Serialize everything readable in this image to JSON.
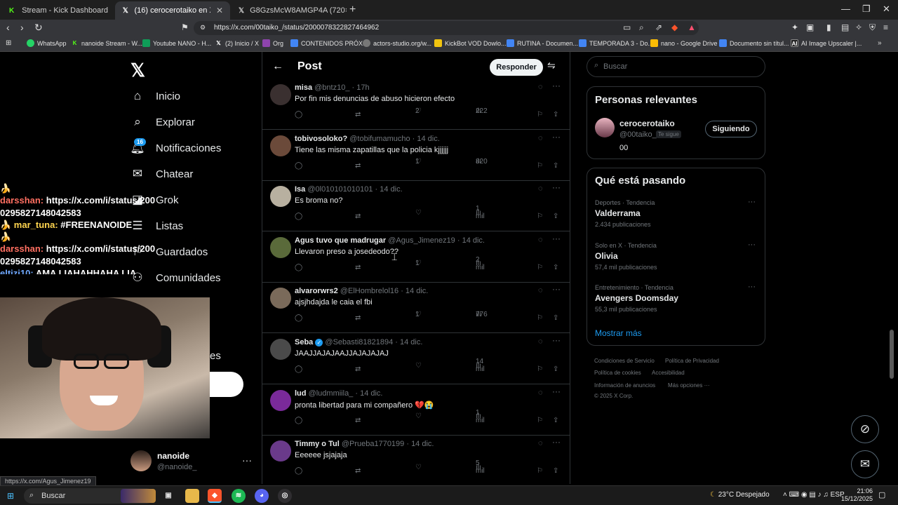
{
  "browser": {
    "tabs": [
      {
        "label": "Stream - Kick Dashboard",
        "icon": "kick-icon"
      },
      {
        "label": "(16) cerocerotaiko en X: \"cayo pr",
        "icon": "x-icon"
      },
      {
        "label": "G8GzsMcW8AMGP4A (720×1280)",
        "icon": "x-icon"
      }
    ],
    "url": "https://x.com/00taiko_/status/2000078322827464962",
    "bookmarks": [
      {
        "label": "WhatsApp",
        "color": "#25d366"
      },
      {
        "label": "nanoide Stream - W...",
        "color": "#53fc18"
      },
      {
        "label": "Youtube NANO - H...",
        "color": "#0f9d58"
      },
      {
        "label": "(2) Inicio / X",
        "color": "#333333"
      },
      {
        "label": "Org",
        "color": "#8e44ad"
      },
      {
        "label": "CONTENIDOS PRÓX...",
        "color": "#4285f4"
      },
      {
        "label": "actors-studio.org/w...",
        "color": "#777777"
      },
      {
        "label": "KickBot VOD Dowlo...",
        "color": "#f1c40f"
      },
      {
        "label": "RUTINA - Documen...",
        "color": "#4285f4"
      },
      {
        "label": "TEMPORADA 3 - Do...",
        "color": "#4285f4"
      },
      {
        "label": "nano - Google Drive",
        "color": "#fbbc04"
      },
      {
        "label": "Documento sin títul...",
        "color": "#4285f4"
      },
      {
        "label": "AI Image Upscaler |...",
        "color": "#222222"
      }
    ]
  },
  "chat": {
    "lines": [
      {
        "user": "",
        "text": "🍌"
      },
      {
        "user": "darsshan:",
        "text": "https://x.com/i/status/200"
      },
      {
        "user": "",
        "text": "0295827148042583"
      },
      {
        "user": "🍌 mar_tuna:",
        "text": "#FREENANOIDE"
      },
      {
        "user": "",
        "text": "🍌"
      },
      {
        "user": "darsshan:",
        "text": "https://x.com/i/status/200"
      },
      {
        "user": "",
        "text": "0295827148042583"
      },
      {
        "user": "eltizi10:",
        "text": "AMA LIAHAHHAHA LIA"
      }
    ]
  },
  "sidebar": {
    "nav": [
      {
        "label": "Inicio",
        "icon": "home-icon"
      },
      {
        "label": "Explorar",
        "icon": "search-icon"
      },
      {
        "label": "Notificaciones",
        "icon": "bell-icon"
      },
      {
        "label": "Chatear",
        "icon": "mail-icon"
      },
      {
        "label": "Grok",
        "icon": "grok-icon"
      },
      {
        "label": "Listas",
        "icon": "list-icon"
      },
      {
        "label": "Guardados",
        "icon": "bookmark-icon"
      },
      {
        "label": "Comunidades",
        "icon": "communities-icon"
      }
    ],
    "notif_badge": "16",
    "fragment": "es",
    "account": {
      "name": "nanoide",
      "handle": "@nanoide_"
    }
  },
  "statusbar": "https://x.com/Agus_Jimenez19",
  "post": {
    "title": "Post",
    "reply_button": "Responder"
  },
  "replies": [
    {
      "name": "misa",
      "handle": "@bntz10_ · 17h",
      "text": "Por fin mis denuncias de abuso hicieron efecto",
      "likes": "2",
      "views": "222",
      "verified": false,
      "avatar": "#3a3030"
    },
    {
      "name": "tobivosoloko?",
      "handle": "@tobifumamucho · 14 dic.",
      "text": "Tiene las misma zapatillas que la policia kjjjjjj",
      "likes": "1",
      "views": "820",
      "verified": false,
      "avatar": "#6b4a3a"
    },
    {
      "name": "Isa",
      "handle": "@0l010101010101 · 14 dic.",
      "text": "Es broma no?",
      "likes": "",
      "views": "1 mil",
      "verified": false,
      "avatar": "#b8b0a0"
    },
    {
      "name": "Agus tuvo que madrugar",
      "handle": "@Agus_Jimenez19 · 14 dic.",
      "text": "Llevaron preso a josedeodo??",
      "likes": "1",
      "views": "2 mil",
      "verified": false,
      "avatar": "#5a6a3a"
    },
    {
      "name": "alvarorwrs2",
      "handle": "@ElHombrelol16 · 14 dic.",
      "text": "ajsjhdajda le caia el fbi",
      "likes": "1",
      "views": "776",
      "verified": false,
      "avatar": "#7a6a5a"
    },
    {
      "name": "Seba",
      "handle": "@Sebasti81821894 · 14 dic.",
      "text": "JAAJJAJAJAAJJAJAJAJAJ",
      "likes": "",
      "views": "14 mil",
      "verified": true,
      "avatar": "#4a4a4a"
    },
    {
      "name": "lud",
      "handle": "@ludmmiila_ · 14 dic.",
      "text": "pronta libertad para mi compañero 💔😭",
      "likes": "",
      "views": "1 mil",
      "verified": false,
      "avatar": "#7a2a9a"
    },
    {
      "name": "Timmy o Tul",
      "handle": "@Prueba1770199 · 14 dic.",
      "text": "Eeeeee jsjajaja",
      "likes": "",
      "views": "5 mil",
      "verified": false,
      "avatar": "#6a3a8a"
    }
  ],
  "right": {
    "search_placeholder": "Buscar",
    "relevant": {
      "title": "Personas relevantes",
      "name": "cerocerotaiko",
      "handle": "@00taiko_",
      "follows_you": "Te sigue",
      "bio": "00",
      "follow_button": "Siguiendo"
    },
    "trends_title": "Qué está pasando",
    "trends": [
      {
        "category": "Deportes · Tendencia",
        "name": "Valderrama",
        "posts": "2.434 publicaciones"
      },
      {
        "category": "Solo en X · Tendencia",
        "name": "Olivia",
        "posts": "57,4 mil publicaciones"
      },
      {
        "category": "Entretenimiento · Tendencia",
        "name": "Avengers Doomsday",
        "posts": "55,3 mil publicaciones"
      }
    ],
    "show_more": "Mostrar más",
    "footer": {
      "terms": "Condiciones de Servicio",
      "privacy": "Política de Privacidad",
      "cookies": "Política de cookies",
      "accessibility": "Accesibilidad",
      "ads": "Información de anuncios",
      "more": "Más opciones ···",
      "copyright": "© 2025 X Corp."
    }
  },
  "taskbar": {
    "search": "Buscar",
    "weather": "23°C  Despejado",
    "lang": "ESP",
    "time": "21:06",
    "date": "15/12/2025"
  }
}
